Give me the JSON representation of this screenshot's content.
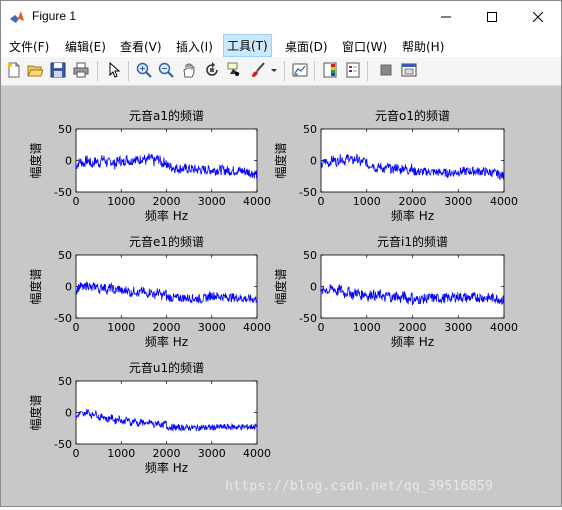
{
  "window": {
    "title": "Figure 1",
    "controls": {
      "minimize": "—",
      "maximize": "☐",
      "close": "✕"
    }
  },
  "menubar": {
    "items": [
      {
        "label": "文件(F)"
      },
      {
        "label": "编辑(E)"
      },
      {
        "label": "查看(V)"
      },
      {
        "label": "插入(I)"
      },
      {
        "label": "工具(T)",
        "active": true
      },
      {
        "label": "桌面(D)"
      },
      {
        "label": "窗口(W)"
      },
      {
        "label": "帮助(H)"
      }
    ],
    "dock_glyph": "↘"
  },
  "toolbar": {
    "icons": [
      "new-figure-icon",
      "open-folder-icon",
      "save-icon",
      "print-icon",
      "pointer-icon",
      "zoom-in-icon",
      "zoom-out-icon",
      "pan-hand-icon",
      "rotate-3d-icon",
      "data-cursor-icon",
      "brush-icon",
      "brush-dropdown-icon",
      "link-plot-icon",
      "colorbar-icon",
      "legend-icon",
      "hide-plot-tools-icon",
      "show-plot-tools-icon"
    ]
  },
  "figure": {
    "background": "#c8c8c8",
    "line_color": "#0000ff",
    "xlabel": "频率 Hz",
    "ylabel": "幅度谱",
    "x_ticks": [
      "0",
      "1000",
      "2000",
      "3000",
      "4000"
    ],
    "y_ticks": [
      "50",
      "0",
      "-50"
    ],
    "xlim": [
      0,
      4000
    ],
    "ylim": [
      -50,
      50
    ]
  },
  "chart_data": [
    {
      "type": "line",
      "title": "元音a1的频谱",
      "xlabel": "频率 Hz",
      "ylabel": "幅度谱",
      "xlim": [
        0,
        4000
      ],
      "ylim": [
        -50,
        50
      ],
      "x_ticks": [
        0,
        1000,
        2000,
        3000,
        4000
      ],
      "y_ticks": [
        -50,
        0,
        50
      ],
      "x": [
        0,
        200,
        400,
        600,
        800,
        1000,
        1200,
        1400,
        1600,
        1800,
        2000,
        2200,
        2400,
        2600,
        2800,
        3000,
        3200,
        3400,
        3600,
        3800,
        4000
      ],
      "y": [
        -10,
        -5,
        -8,
        -3,
        -8,
        -5,
        -3,
        -2,
        -2,
        -3,
        -8,
        -12,
        -13,
        -14,
        -15,
        -15,
        -15,
        -16,
        -16,
        -18,
        -22
      ],
      "noise": 8
    },
    {
      "type": "line",
      "title": "元音o1的频谱",
      "xlabel": "频率 Hz",
      "ylabel": "幅度谱",
      "xlim": [
        0,
        4000
      ],
      "ylim": [
        -50,
        50
      ],
      "x_ticks": [
        0,
        1000,
        2000,
        3000,
        4000
      ],
      "y_ticks": [
        -50,
        0,
        50
      ],
      "x": [
        0,
        200,
        400,
        600,
        800,
        1000,
        1200,
        1400,
        1600,
        1800,
        2000,
        2200,
        2400,
        2600,
        2800,
        3000,
        3200,
        3400,
        3600,
        3800,
        4000
      ],
      "y": [
        -10,
        -5,
        -3,
        -1,
        -3,
        -8,
        -15,
        -16,
        -17,
        -17,
        -17,
        -18,
        -18,
        -19,
        -20,
        -18,
        -17,
        -17,
        -18,
        -20,
        -25
      ],
      "noise": 7
    },
    {
      "type": "line",
      "title": "元音e1的频谱",
      "xlabel": "频率 Hz",
      "ylabel": "幅度谱",
      "xlim": [
        0,
        4000
      ],
      "ylim": [
        -50,
        50
      ],
      "x_ticks": [
        0,
        1000,
        2000,
        3000,
        4000
      ],
      "y_ticks": [
        -50,
        0,
        50
      ],
      "x": [
        0,
        200,
        400,
        600,
        800,
        1000,
        1200,
        1400,
        1600,
        1800,
        2000,
        2200,
        2400,
        2600,
        2800,
        3000,
        3200,
        3400,
        3600,
        3800,
        4000
      ],
      "y": [
        -8,
        -3,
        -5,
        -6,
        -8,
        -10,
        -12,
        -13,
        -14,
        -15,
        -17,
        -18,
        -18,
        -19,
        -20,
        -14,
        -16,
        -17,
        -18,
        -20,
        -20
      ],
      "noise": 7
    },
    {
      "type": "line",
      "title": "元音i1的频谱",
      "xlabel": "频率 Hz",
      "ylabel": "幅度谱",
      "xlim": [
        0,
        4000
      ],
      "ylim": [
        -50,
        50
      ],
      "x_ticks": [
        0,
        1000,
        2000,
        3000,
        4000
      ],
      "y_ticks": [
        -50,
        0,
        50
      ],
      "x": [
        0,
        200,
        400,
        600,
        800,
        1000,
        1200,
        1400,
        1600,
        1800,
        2000,
        2200,
        2400,
        2600,
        2800,
        3000,
        3200,
        3400,
        3600,
        3800,
        4000
      ],
      "y": [
        -12,
        -8,
        -10,
        -14,
        -15,
        -17,
        -18,
        -20,
        -20,
        -21,
        -22,
        -20,
        -18,
        -19,
        -18,
        -16,
        -18,
        -17,
        -18,
        -18,
        -22
      ],
      "noise": 8
    },
    {
      "type": "line",
      "title": "元音u1的频谱",
      "xlabel": "频率 Hz",
      "ylabel": "幅度谱",
      "xlim": [
        0,
        4000
      ],
      "ylim": [
        -50,
        50
      ],
      "x_ticks": [
        0,
        1000,
        2000,
        3000,
        4000
      ],
      "y_ticks": [
        -50,
        0,
        50
      ],
      "x": [
        0,
        200,
        400,
        600,
        800,
        1000,
        1200,
        1400,
        1600,
        1800,
        2000,
        2200,
        2400,
        2600,
        2800,
        3000,
        3200,
        3400,
        3600,
        3800,
        4000
      ],
      "y": [
        -10,
        -4,
        -6,
        -12,
        -14,
        -16,
        -18,
        -20,
        -21,
        -22,
        -23,
        -24,
        -24,
        -24,
        -24,
        -24,
        -23,
        -23,
        -23,
        -23,
        -22
      ],
      "noise": 5
    }
  ],
  "watermark": "https://blog.csdn.net/qq_39516859"
}
